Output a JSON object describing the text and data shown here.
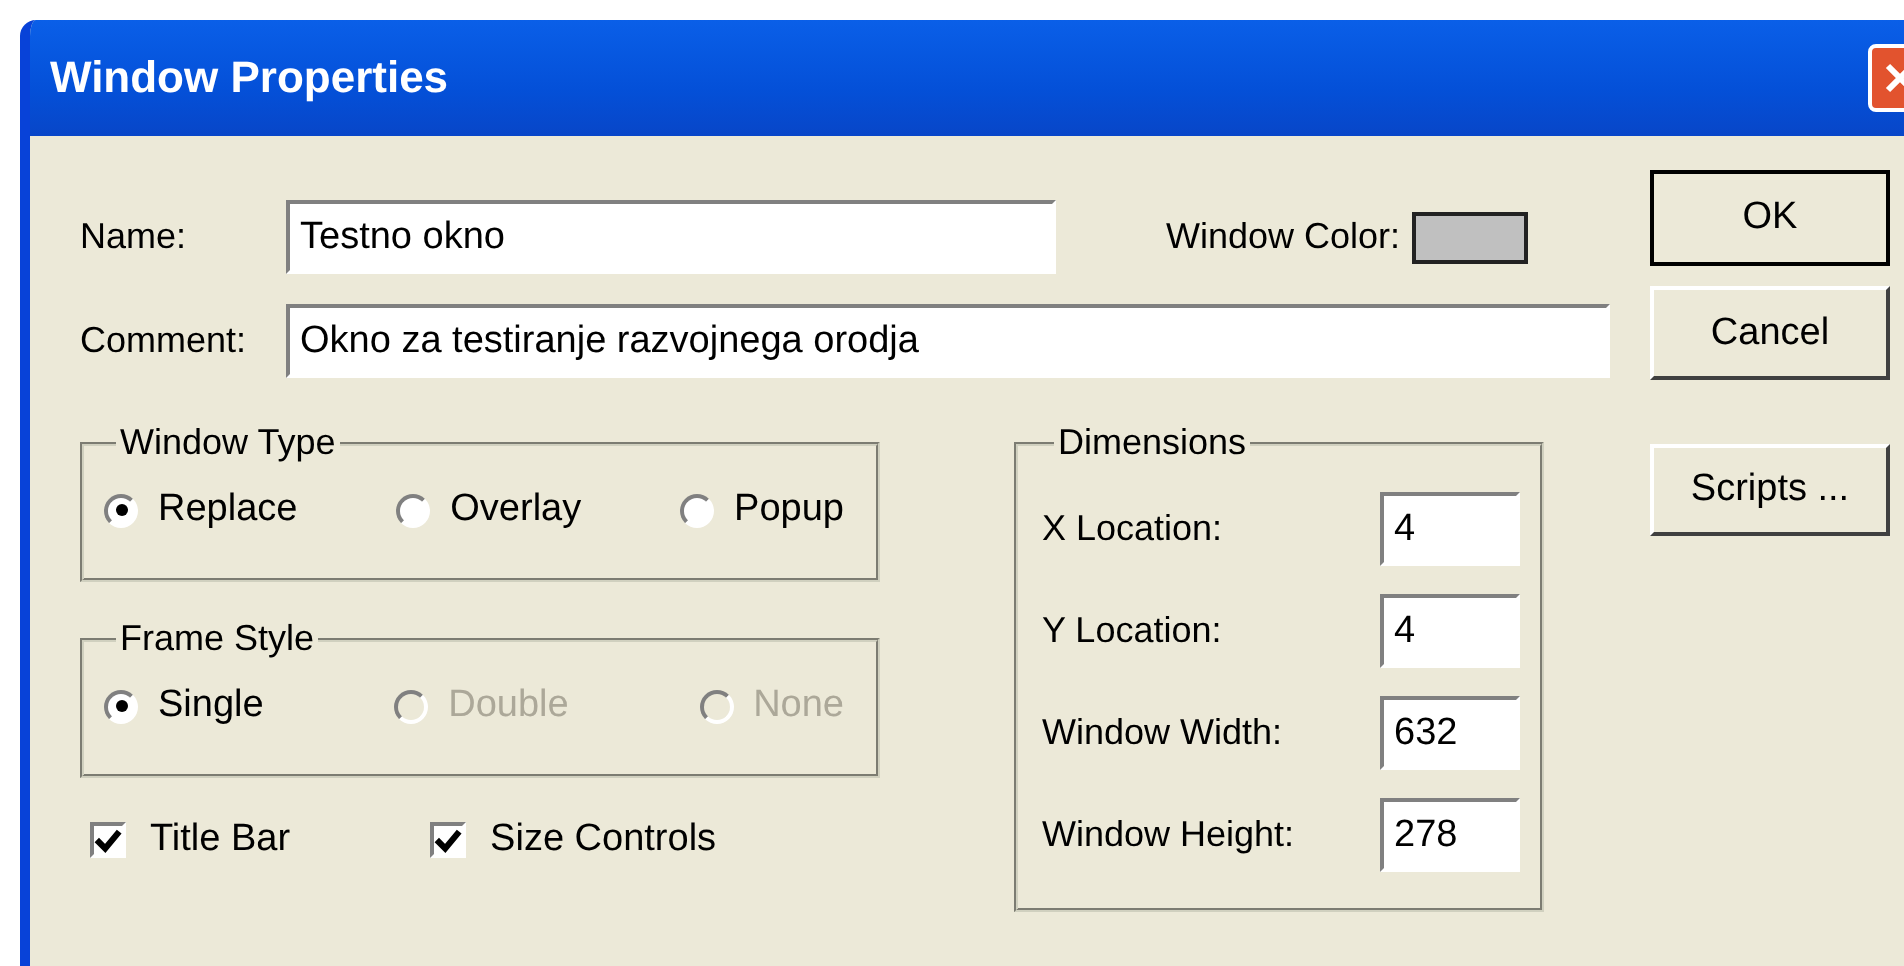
{
  "window": {
    "title": "Window Properties"
  },
  "name": {
    "label": "Name:",
    "value": "Testno okno"
  },
  "window_color": {
    "label": "Window Color:",
    "color": "#c0c0c0"
  },
  "comment": {
    "label": "Comment:",
    "value": "Okno za testiranje razvojnega orodja"
  },
  "window_type": {
    "title": "Window Type",
    "options": [
      {
        "label": "Replace",
        "selected": true,
        "disabled": false
      },
      {
        "label": "Overlay",
        "selected": false,
        "disabled": false
      },
      {
        "label": "Popup",
        "selected": false,
        "disabled": false
      }
    ]
  },
  "frame_style": {
    "title": "Frame Style",
    "options": [
      {
        "label": "Single",
        "selected": true,
        "disabled": false
      },
      {
        "label": "Double",
        "selected": false,
        "disabled": true
      },
      {
        "label": "None",
        "selected": false,
        "disabled": true
      }
    ]
  },
  "checkboxes": [
    {
      "label": "Title Bar",
      "checked": true
    },
    {
      "label": "Size Controls",
      "checked": true
    }
  ],
  "dimensions": {
    "title": "Dimensions",
    "fields": [
      {
        "label": "X Location:",
        "value": "4"
      },
      {
        "label": "Y Location:",
        "value": "4"
      },
      {
        "label": "Window Width:",
        "value": "632"
      },
      {
        "label": "Window Height:",
        "value": "278"
      }
    ]
  },
  "buttons": [
    "OK",
    "Cancel",
    "Scripts ..."
  ]
}
